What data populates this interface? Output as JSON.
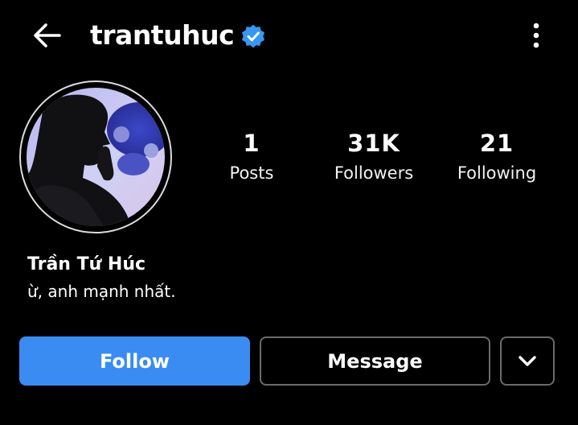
{
  "header": {
    "username": "trantuhuc",
    "verified": true,
    "back_icon": "arrow-left-icon",
    "more_icon": "vertical-dots-icon",
    "verified_icon": "verified-badge-icon",
    "verified_color": "#3897f0"
  },
  "profile": {
    "full_name": "Trần Tứ Húc",
    "bio": "ừ, anh mạnh nhất."
  },
  "stats": {
    "posts": {
      "value": "1",
      "label": "Posts"
    },
    "followers": {
      "value": "31K",
      "label": "Followers"
    },
    "following": {
      "value": "21",
      "label": "Following"
    }
  },
  "actions": {
    "follow_label": "Follow",
    "message_label": "Message",
    "dropdown_icon": "chevron-down-icon",
    "follow_color": "#3a8cf2"
  }
}
